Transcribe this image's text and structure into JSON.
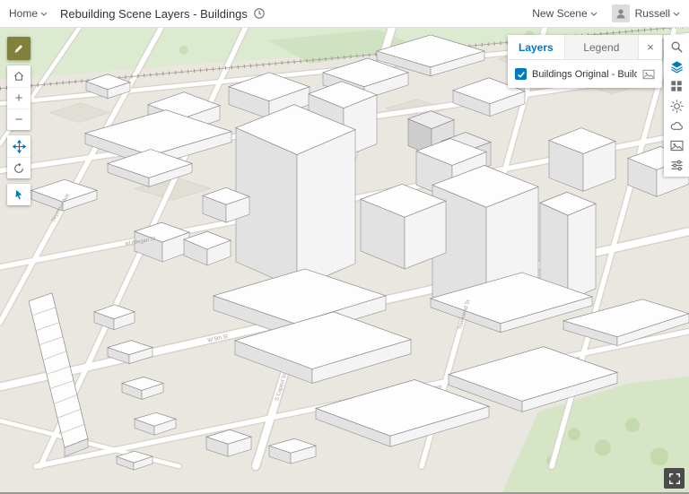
{
  "header": {
    "home_label": "Home",
    "title": "Rebuilding Scene Layers - Buildings",
    "new_scene_label": "New Scene",
    "user_name": "Russell"
  },
  "left_toolbar": {
    "zoom_in_label": "+",
    "zoom_out_label": "−",
    "tools": [
      "edit",
      "home",
      "zoom-in",
      "zoom-out",
      "pan",
      "rotate",
      "select"
    ],
    "active_tools": [
      "edit",
      "pan",
      "select"
    ]
  },
  "layers_panel": {
    "tabs": [
      {
        "label": "Layers",
        "active": true
      },
      {
        "label": "Legend",
        "active": false
      }
    ],
    "close_label": "×",
    "layers": [
      {
        "label": "Buildings Original - Building...",
        "checked": true
      }
    ]
  },
  "right_toolbar": {
    "icons": [
      "search",
      "layers",
      "basemap",
      "daylight",
      "weather",
      "slides",
      "settings"
    ],
    "active_icon": "layers"
  },
  "map": {
    "street_labels": [
      {
        "text": "Seymour Ave"
      },
      {
        "text": "W Allegan St"
      },
      {
        "text": "W 5th St"
      },
      {
        "text": "S Capitol St"
      },
      {
        "text": "Townsend St"
      }
    ]
  },
  "colors": {
    "accent": "#0079c1",
    "edit_tool_bg": "#81813c",
    "ground": "#e9e7df",
    "park_green": "#d7e6c9",
    "building_top": "#fdfdfd",
    "building_side": "#e2e2e2"
  }
}
